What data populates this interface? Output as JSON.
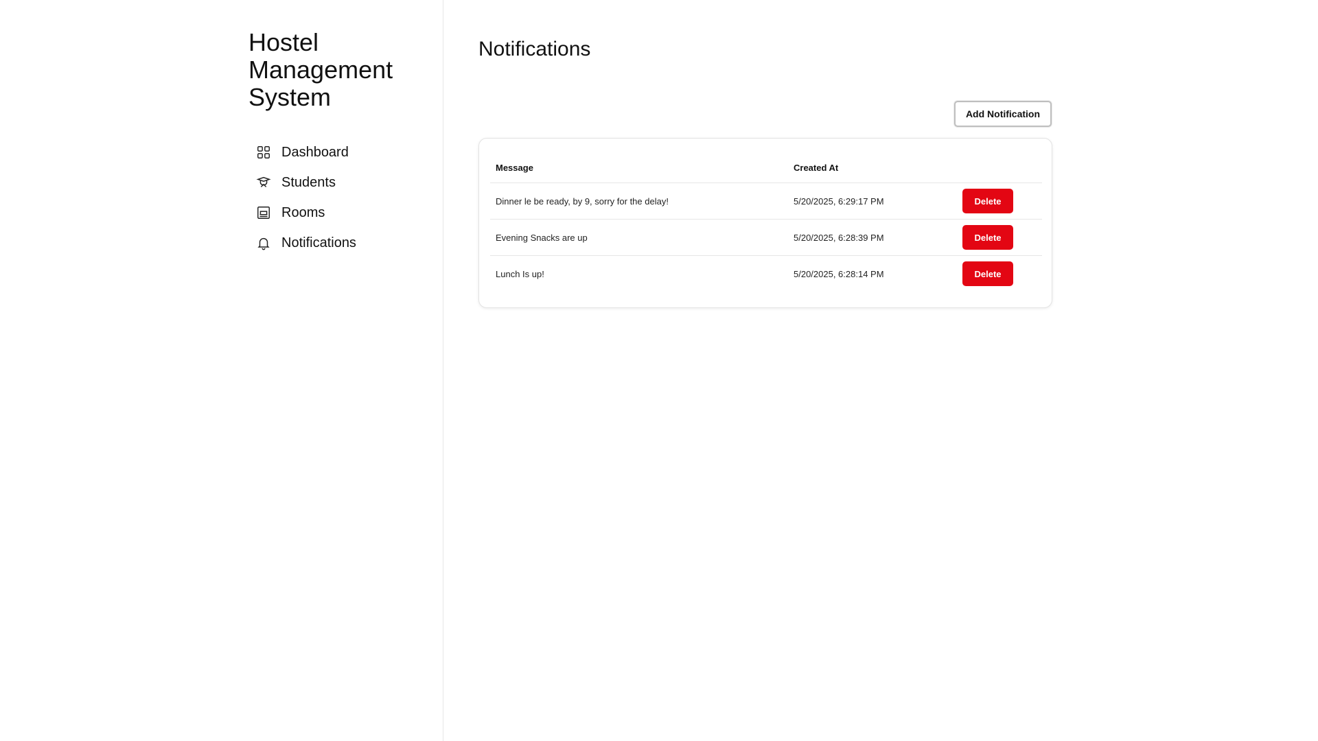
{
  "sidebar": {
    "brand": "Hostel Management System",
    "items": [
      {
        "label": "Dashboard",
        "icon": "dashboard-grid-icon"
      },
      {
        "label": "Students",
        "icon": "student-graduation-icon"
      },
      {
        "label": "Rooms",
        "icon": "room-bed-icon"
      },
      {
        "label": "Notifications",
        "icon": "bell-icon"
      }
    ]
  },
  "main": {
    "title": "Notifications",
    "add_button_label": "Add Notification",
    "table": {
      "columns": [
        "Message",
        "Created At",
        ""
      ],
      "rows": [
        {
          "message": "Dinner le be ready, by 9, sorry for the delay!",
          "created_at": "5/20/2025, 6:29:17 PM",
          "action": "Delete"
        },
        {
          "message": "Evening Snacks are up",
          "created_at": "5/20/2025, 6:28:39 PM",
          "action": "Delete"
        },
        {
          "message": "Lunch Is up!",
          "created_at": "5/20/2025, 6:28:14 PM",
          "action": "Delete"
        }
      ]
    }
  },
  "colors": {
    "delete_button": "#e30613",
    "background": "#ffffff",
    "border": "#e6e6e6"
  }
}
